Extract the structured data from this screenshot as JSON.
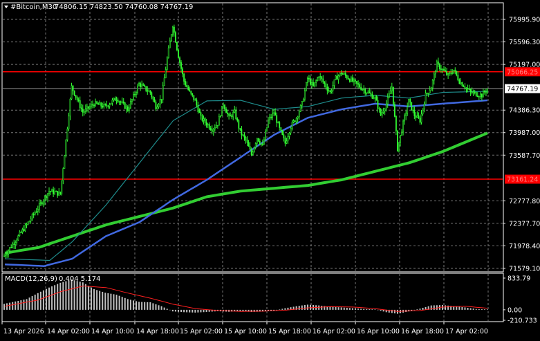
{
  "header": {
    "symbol_text": "#Bitcoin,M30",
    "ohlc_text": "74806.15 74823.50 74760.08 74767.19"
  },
  "indicator": {
    "label": "MACD(12,26,9)",
    "values_text": "0.404 5.174"
  },
  "colors": {
    "background": "#000000",
    "grid": "#777777",
    "candle": "#33ff33",
    "ma_teal": "#1e8c8c",
    "ma_blue": "#4169e1",
    "ma_green": "#32cd32",
    "hline": "#ff0000",
    "macd_hist": "#c0c0c0",
    "macd_signal": "#ff2020",
    "axis_text": "#ffffff"
  },
  "chart_data": {
    "type": "candlestick",
    "timeframe": "M30",
    "x_labels": [
      "13 Apr 2026",
      "14 Apr 02:00",
      "14 Apr 10:00",
      "14 Apr 18:00",
      "15 Apr 02:00",
      "15 Apr 10:00",
      "15 Apr 18:00",
      "16 Apr 02:00",
      "16 Apr 10:00",
      "16 Apr 18:00",
      "17 Apr 02:00"
    ],
    "y_ticks": [
      "75995.90",
      "75596.30",
      "75197.00",
      "74386.30",
      "73987.00",
      "73587.70",
      "72777.80",
      "72377.70",
      "71978.40",
      "71579.10"
    ],
    "ylim": [
      71579.1,
      76197.0
    ],
    "price_tags": [
      {
        "text": "75066.25",
        "value": 75066.25,
        "type": "level"
      },
      {
        "text": "74767.19",
        "value": 74767.19,
        "type": "bid"
      },
      {
        "text": "73161.24",
        "value": 73161.24,
        "type": "level"
      }
    ],
    "horizontal_lines": [
      75066.25,
      73161.24
    ],
    "macd_ticks": [
      "833.79",
      "0.00",
      "-210.733"
    ],
    "macd_ylim": [
      -210.733,
      833.79
    ],
    "price_path": [
      [
        0,
        71800
      ],
      [
        4,
        72350
      ],
      [
        8,
        72950
      ],
      [
        10,
        72900
      ],
      [
        12,
        74800
      ],
      [
        14,
        74350
      ],
      [
        16,
        74500
      ],
      [
        18,
        74450
      ],
      [
        20,
        74600
      ],
      [
        22,
        74400
      ],
      [
        24,
        74850
      ],
      [
        26,
        74700
      ],
      [
        27,
        74450
      ],
      [
        28,
        74600
      ],
      [
        29,
        75300
      ],
      [
        30,
        75900
      ],
      [
        31,
        75350
      ],
      [
        32,
        74900
      ],
      [
        33,
        74700
      ],
      [
        34,
        74550
      ],
      [
        35,
        74250
      ],
      [
        36,
        74150
      ],
      [
        37,
        74050
      ],
      [
        38,
        74150
      ],
      [
        39,
        74500
      ],
      [
        40,
        74250
      ],
      [
        41,
        74350
      ],
      [
        42,
        74000
      ],
      [
        43,
        73850
      ],
      [
        44,
        73600
      ],
      [
        45,
        73900
      ],
      [
        46,
        73750
      ],
      [
        47,
        74200
      ],
      [
        48,
        74350
      ],
      [
        49,
        74050
      ],
      [
        50,
        73800
      ],
      [
        51,
        74100
      ],
      [
        52,
        74250
      ],
      [
        53,
        74500
      ],
      [
        54,
        74950
      ],
      [
        55,
        74800
      ],
      [
        56,
        75000
      ],
      [
        57,
        74850
      ],
      [
        58,
        74700
      ],
      [
        59,
        74950
      ],
      [
        60,
        75050
      ],
      [
        62,
        74900
      ],
      [
        64,
        74750
      ],
      [
        66,
        74600
      ],
      [
        67,
        74300
      ],
      [
        68,
        74500
      ],
      [
        69,
        74800
      ],
      [
        70,
        73700
      ],
      [
        71,
        74150
      ],
      [
        72,
        74550
      ],
      [
        73,
        74300
      ],
      [
        74,
        74200
      ],
      [
        75,
        74650
      ],
      [
        76,
        74800
      ],
      [
        77,
        75200
      ],
      [
        78,
        75100
      ],
      [
        79,
        75000
      ],
      [
        80,
        75100
      ],
      [
        81,
        74900
      ],
      [
        82,
        74800
      ],
      [
        83,
        74700
      ],
      [
        85,
        74650
      ],
      [
        86,
        74767.19
      ]
    ],
    "ma_teal": [
      [
        0,
        71750
      ],
      [
        8,
        71720
      ],
      [
        12,
        72050
      ],
      [
        18,
        72700
      ],
      [
        24,
        73450
      ],
      [
        30,
        74200
      ],
      [
        36,
        74550
      ],
      [
        42,
        74560
      ],
      [
        48,
        74400
      ],
      [
        54,
        74450
      ],
      [
        60,
        74600
      ],
      [
        66,
        74650
      ],
      [
        72,
        74600
      ],
      [
        78,
        74700
      ],
      [
        86,
        74720
      ]
    ],
    "ma_blue": [
      [
        0,
        71650
      ],
      [
        7,
        71620
      ],
      [
        12,
        71750
      ],
      [
        18,
        72150
      ],
      [
        24,
        72400
      ],
      [
        30,
        72800
      ],
      [
        36,
        73150
      ],
      [
        42,
        73550
      ],
      [
        48,
        73950
      ],
      [
        54,
        74250
      ],
      [
        60,
        74400
      ],
      [
        66,
        74500
      ],
      [
        72,
        74450
      ],
      [
        78,
        74500
      ],
      [
        86,
        74560
      ]
    ],
    "ma_green": [
      [
        0,
        71850
      ],
      [
        6,
        71950
      ],
      [
        12,
        72150
      ],
      [
        18,
        72350
      ],
      [
        24,
        72500
      ],
      [
        30,
        72650
      ],
      [
        36,
        72850
      ],
      [
        42,
        72950
      ],
      [
        48,
        73000
      ],
      [
        54,
        73050
      ],
      [
        60,
        73150
      ],
      [
        66,
        73300
      ],
      [
        72,
        73450
      ],
      [
        78,
        73650
      ],
      [
        86,
        73980
      ]
    ],
    "macd_hist": [
      [
        0,
        150
      ],
      [
        4,
        270
      ],
      [
        6,
        420
      ],
      [
        8,
        560
      ],
      [
        10,
        680
      ],
      [
        12,
        760
      ],
      [
        14,
        690
      ],
      [
        16,
        520
      ],
      [
        18,
        430
      ],
      [
        20,
        380
      ],
      [
        22,
        270
      ],
      [
        24,
        200
      ],
      [
        26,
        190
      ],
      [
        28,
        90
      ],
      [
        30,
        -40
      ],
      [
        32,
        -60
      ],
      [
        34,
        -70
      ],
      [
        36,
        -55
      ],
      [
        38,
        -35
      ],
      [
        40,
        -50
      ],
      [
        42,
        -30
      ],
      [
        44,
        -55
      ],
      [
        46,
        -45
      ],
      [
        48,
        -20
      ],
      [
        50,
        40
      ],
      [
        52,
        90
      ],
      [
        54,
        130
      ],
      [
        56,
        110
      ],
      [
        58,
        80
      ],
      [
        60,
        60
      ],
      [
        62,
        40
      ],
      [
        64,
        20
      ],
      [
        66,
        10
      ],
      [
        68,
        -60
      ],
      [
        70,
        -100
      ],
      [
        72,
        -40
      ],
      [
        74,
        30
      ],
      [
        76,
        110
      ],
      [
        78,
        120
      ],
      [
        80,
        90
      ],
      [
        82,
        60
      ],
      [
        84,
        20
      ],
      [
        86,
        10
      ]
    ],
    "macd_signal": [
      [
        0,
        90
      ],
      [
        6,
        250
      ],
      [
        10,
        460
      ],
      [
        14,
        600
      ],
      [
        18,
        560
      ],
      [
        22,
        420
      ],
      [
        26,
        290
      ],
      [
        30,
        140
      ],
      [
        34,
        30
      ],
      [
        38,
        -20
      ],
      [
        42,
        -40
      ],
      [
        46,
        -35
      ],
      [
        50,
        -10
      ],
      [
        54,
        50
      ],
      [
        58,
        80
      ],
      [
        62,
        70
      ],
      [
        66,
        30
      ],
      [
        70,
        -40
      ],
      [
        74,
        -20
      ],
      [
        78,
        70
      ],
      [
        82,
        90
      ],
      [
        86,
        40
      ]
    ]
  }
}
